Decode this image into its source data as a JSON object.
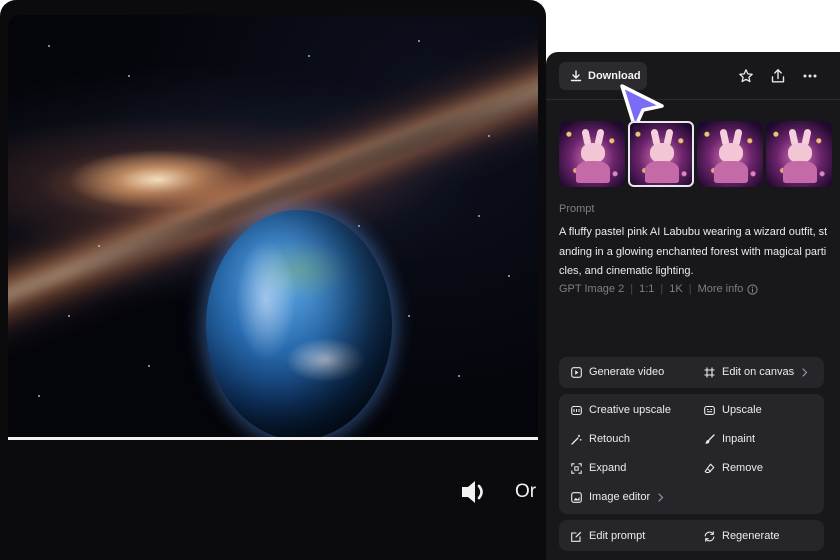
{
  "video": {
    "subtitle_text": "Or",
    "volume_icon": "speaker-icon"
  },
  "panel": {
    "download_label": "Download",
    "header_icons": [
      "star-icon",
      "share-icon",
      "more-icon"
    ],
    "thumbnails_count": 4,
    "selected_thumbnail": 2,
    "prompt_label": "Prompt",
    "prompt_text": "A fluffy pastel pink AI Labubu wearing a wizard outfit, standing in a glowing enchanted forest with magical particles, and cinematic lighting.",
    "meta": {
      "model": "GPT Image 2",
      "ratio": "1:1",
      "resolution": "1K",
      "more_info": "More info"
    },
    "group1": {
      "generate_video": "Generate video",
      "edit_on_canvas": "Edit on canvas"
    },
    "group2": {
      "creative_upscale": "Creative upscale",
      "upscale": "Upscale",
      "retouch": "Retouch",
      "inpaint": "Inpaint",
      "expand": "Expand",
      "remove": "Remove",
      "image_editor": "Image editor"
    },
    "group3": {
      "edit_prompt": "Edit prompt",
      "regenerate": "Regenerate"
    }
  },
  "colors": {
    "panel_bg": "#18181b",
    "group_bg": "#25252a",
    "cursor_accent": "#7b6cf6"
  }
}
